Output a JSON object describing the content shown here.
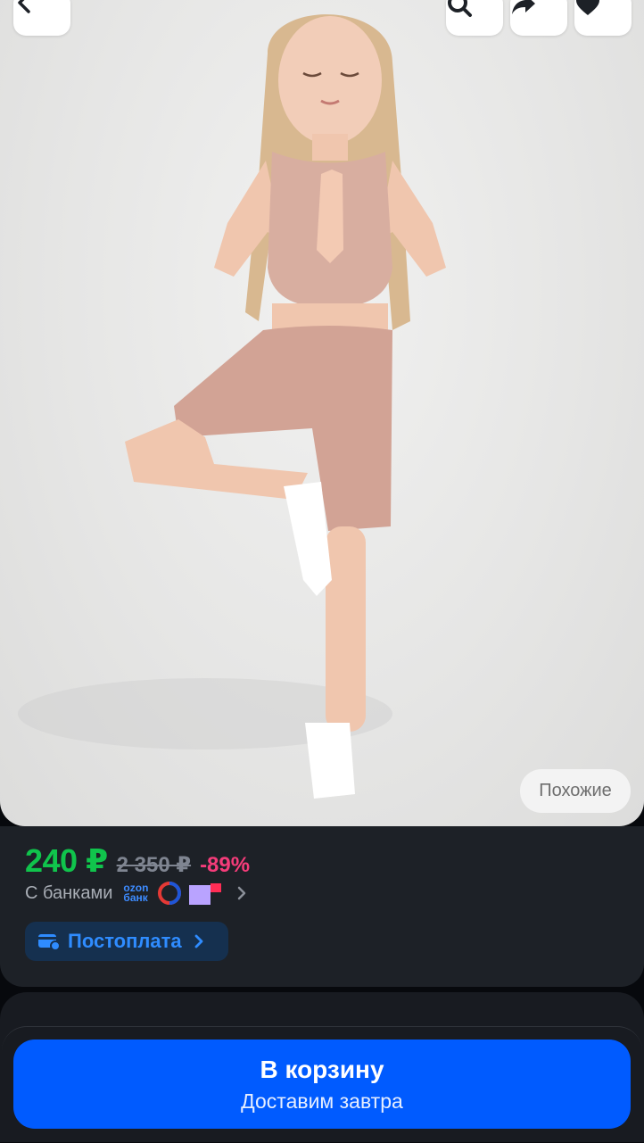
{
  "header": {
    "back_icon": "chevron-left-icon",
    "search_icon": "search-icon",
    "share_icon": "share-icon",
    "favorite_icon": "heart-icon"
  },
  "gallery": {
    "similar_label": "Похожие"
  },
  "pricing": {
    "price": "240 ₽",
    "old_price": "2 350 ₽",
    "discount": "-89%",
    "price_color": "#10c44c",
    "discount_color": "#f53c7a"
  },
  "banks": {
    "label": "С банками",
    "ozon_line1": "ozon",
    "ozon_line2": "банк"
  },
  "postpay": {
    "label": "Постоплата"
  },
  "cart": {
    "title": "В корзину",
    "subtitle": "Доставим завтра",
    "color": "#005bff"
  }
}
